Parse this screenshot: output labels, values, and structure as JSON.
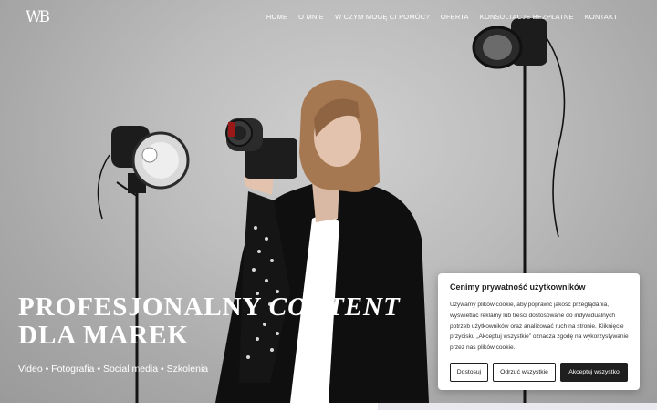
{
  "header": {
    "logo": "WB",
    "nav": [
      {
        "label": "HOME"
      },
      {
        "label": "O MNIE"
      },
      {
        "label": "W CZYM MOGĘ CI POMÓC?"
      },
      {
        "label": "OFERTA"
      },
      {
        "label": "KONSULTACJE BEZPŁATNE"
      },
      {
        "label": "KONTAKT"
      }
    ]
  },
  "hero": {
    "headline_line1_a": "PROFESJONALNY ",
    "headline_line1_b": "CONTENT",
    "headline_line2": "DLA MAREK",
    "tagline": "Video • Fotografia • Social media • Szkolenia"
  },
  "cookie": {
    "title": "Cenimy prywatność użytkowników",
    "text": "Używamy plików cookie, aby poprawić jakość przeglądania, wyświetlać reklamy lub treści dostosowane do indywidualnych potrzeb użytkowników oraz analizować ruch na stronie. Kliknięcie przycisku „Akceptuj wszystkie” oznacza zgodę na wykorzystywanie przez nas plików cookie.",
    "btn_customize": "Dostosuj",
    "btn_reject": "Odrzuć wszystkie",
    "btn_accept": "Akceptuj wszystko"
  },
  "colors": {
    "button_dark": "#1f1f1f",
    "backdrop": "#bdbdbd"
  }
}
